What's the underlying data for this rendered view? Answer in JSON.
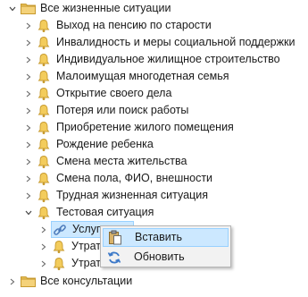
{
  "tree": {
    "root_label": "Все жизненные ситуации",
    "items": [
      {
        "label": "Выход на пенсию по старости"
      },
      {
        "label": "Инвалидность и меры социальной поддержки"
      },
      {
        "label": "Индивидуальное жилищное строительство"
      },
      {
        "label": "Малоимущая многодетная семья"
      },
      {
        "label": "Открытие своего дела"
      },
      {
        "label": "Потеря или поиск работы"
      },
      {
        "label": "Приобретение жилого помещения"
      },
      {
        "label": "Рождение ребенка"
      },
      {
        "label": "Смена места жительства"
      },
      {
        "label": "Смена пола, ФИО, внешности"
      },
      {
        "label": "Трудная жизненная ситуация"
      }
    ],
    "expanded_item": {
      "label": "Тестовая ситуация",
      "children": [
        {
          "label": "Услуги"
        },
        {
          "label": "Утрата (ж"
        },
        {
          "label": "Утрата б"
        }
      ]
    },
    "consultations_label": "Все консультации"
  },
  "context_menu": {
    "items": [
      {
        "label": "Вставить",
        "icon": "paste-icon"
      },
      {
        "label": "Обновить",
        "icon": "refresh-icon"
      }
    ]
  },
  "colors": {
    "folder": "#e8c15a",
    "bell": "#f3cc5c",
    "selection": "#cce8ff",
    "selection_border": "#99d1ff",
    "menu_bg": "#f2f2f2"
  }
}
